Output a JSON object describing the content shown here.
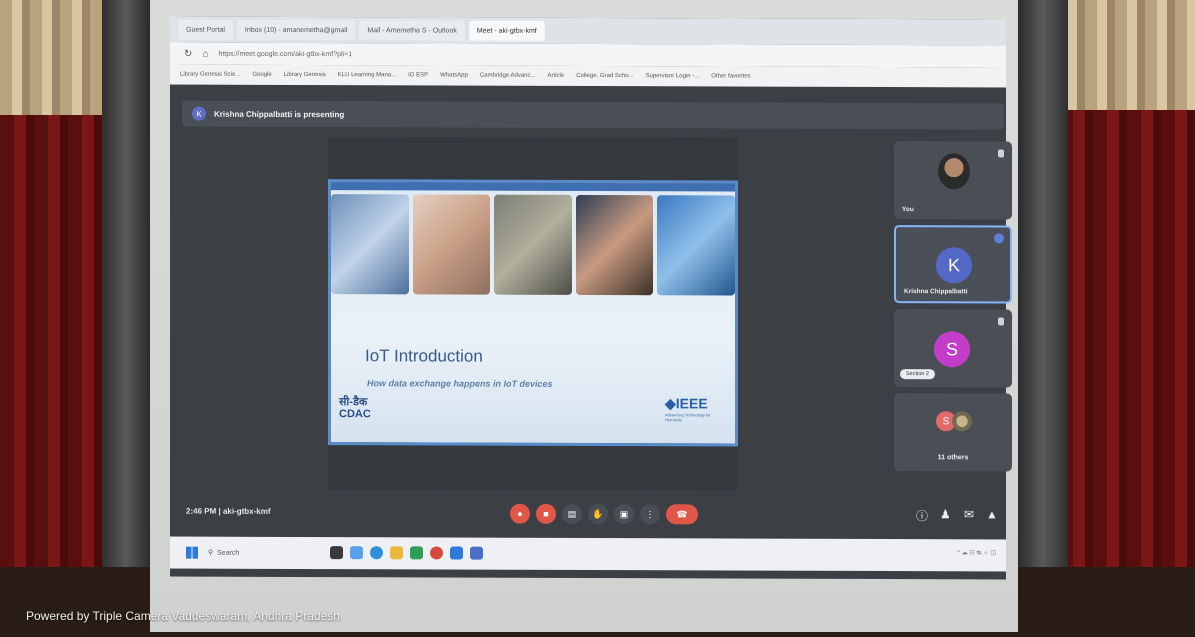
{
  "browser": {
    "tabs": [
      {
        "label": "Guest Portal"
      },
      {
        "label": "Inbox (10) - amanemetha@gmail"
      },
      {
        "label": "Mail - Amemetha S - Outlook"
      },
      {
        "label": "Meet - aki-gtbx-kmf"
      }
    ],
    "url": "https://meet.google.com/aki-gtbx-kmf?pli=1",
    "bookmarks": [
      "Library Genesis Scie...",
      "Google",
      "Library Genesis",
      "KLU Learning Mana...",
      "IG ESP",
      "WhatsApp",
      "Cambridge Advanc...",
      "Article",
      "College, Grad Scho...",
      "Supervisor Login -...",
      "Other favorites"
    ]
  },
  "meet": {
    "presenting_text": "Krishna Chippalbatti is presenting",
    "presenter_initial": "K",
    "meeting_time": "2:46 PM",
    "meeting_code": "aki-gtbx-kmf"
  },
  "slide": {
    "title": "IoT Introduction",
    "subtitle": "How data exchange happens in IoT devices",
    "cdac_hindi": "सी-डैक",
    "cdac_en": "CDAC",
    "ieee_text": "◆IEEE",
    "ieee_tagline": "Advancing Technology for Humanity"
  },
  "participants": {
    "you_label": "You",
    "krishna_initial": "K",
    "krishna_name": "Krishna Chippalbatti",
    "s_initial": "S",
    "section_chip": "Section 2",
    "others_initial": "S",
    "others_label": "11 others"
  },
  "taskbar": {
    "search_label": "Search"
  },
  "watermark": "Powered by Triple Camera   Vaddeswaram, Andhra Pradesh"
}
